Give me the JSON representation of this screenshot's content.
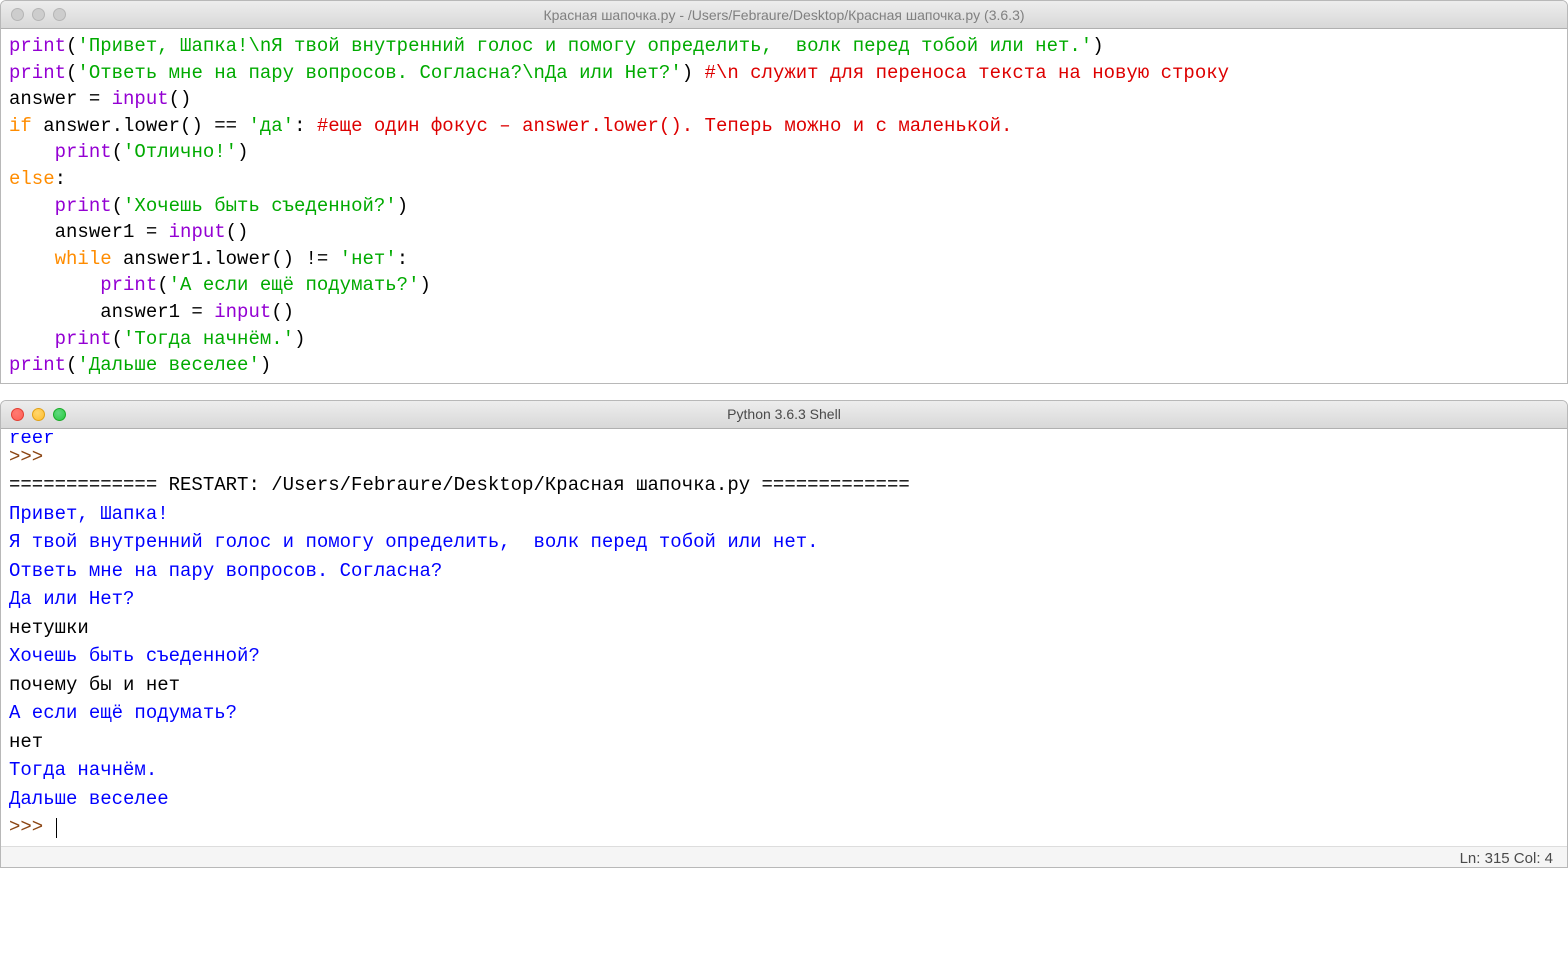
{
  "editor": {
    "title": "Красная шапочка.py - /Users/Febraure/Desktop/Красная шапочка.py (3.6.3)",
    "code": {
      "l1_print": "print",
      "l1_str": "'Привет, Шапка!\\nЯ твой внутренний голос и помогу определить,  волк перед тобой или нет.'",
      "l2_print": "print",
      "l2_str": "'Ответь мне на пару вопросов. Согласна?\\nДа или Нет?'",
      "l2_comment": "#\\n служит для переноса текста на новую строку",
      "l3_var": "answer = ",
      "l3_input": "input",
      "l3_paren": "()",
      "l4_if": "if",
      "l4_cond": " answer.lower() == ",
      "l4_str": "'да'",
      "l4_colon": ": ",
      "l4_comment": "#еще один фокус – answer.lower(). Теперь можно и с маленькой.",
      "l5_print": "print",
      "l5_str": "'Отлично!'",
      "l6_else": "else",
      "l6_colon": ":",
      "l7_print": "print",
      "l7_str": "'Хочешь быть съеденной?'",
      "l8_var": "answer1 = ",
      "l8_input": "input",
      "l8_paren": "()",
      "l9_while": "while",
      "l9_cond": " answer1.lower() != ",
      "l9_str": "'нет'",
      "l9_colon": ":",
      "l10_print": "print",
      "l10_str": "'А если ещё подумать?'",
      "l11_var": "answer1 = ",
      "l11_input": "input",
      "l11_paren": "()",
      "l12_print": "print",
      "l12_str": "'Тогда начнём.'",
      "l13_print": "print",
      "l13_str": "'Дальше веселее'"
    }
  },
  "shell": {
    "title": "Python 3.6.3 Shell",
    "truncated": "reer",
    "prompt": ">>> ",
    "restart": "============= RESTART: /Users/Febraure/Desktop/Красная шапочка.py =============",
    "out1": "Привет, Шапка!",
    "out2": "Я твой внутренний голос и помогу определить,  волк перед тобой или нет.",
    "out3": "Ответь мне на пару вопросов. Согласна?",
    "out4": "Да или Нет?",
    "input1": "нетушки",
    "out5": "Хочешь быть съеденной?",
    "input2": "почему бы и нет",
    "out6": "А если ещё подумать?",
    "input3": "нет",
    "out7": "Тогда начнём.",
    "out8": "Дальше веселее",
    "statusbar": "Ln: 315  Col: 4"
  }
}
